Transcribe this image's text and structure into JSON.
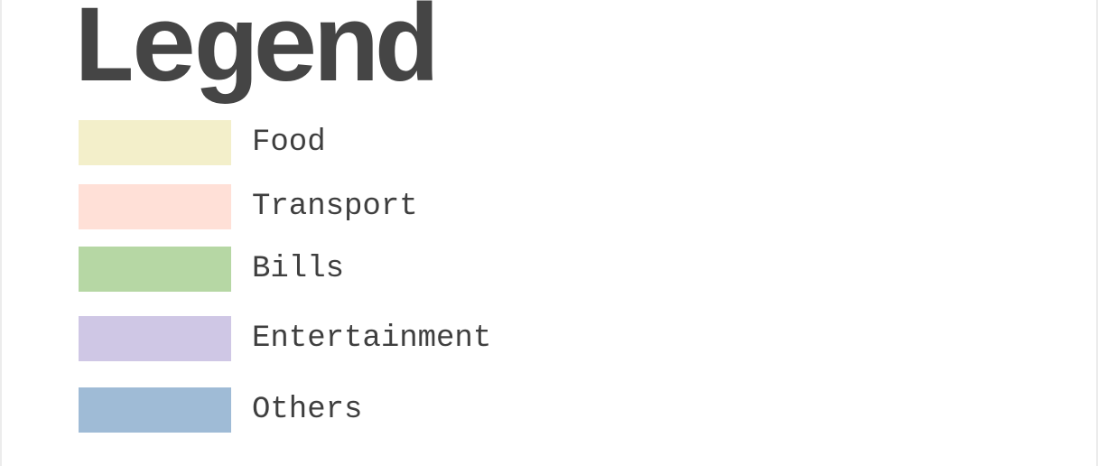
{
  "title": "Legend",
  "legend": {
    "items": [
      {
        "label": "Food",
        "color": "#f3efca"
      },
      {
        "label": "Transport",
        "color": "#ffe0d7"
      },
      {
        "label": "Bills",
        "color": "#b6d7a4"
      },
      {
        "label": "Entertainment",
        "color": "#cfc7e5"
      },
      {
        "label": "Others",
        "color": "#9fbbd6"
      }
    ]
  }
}
